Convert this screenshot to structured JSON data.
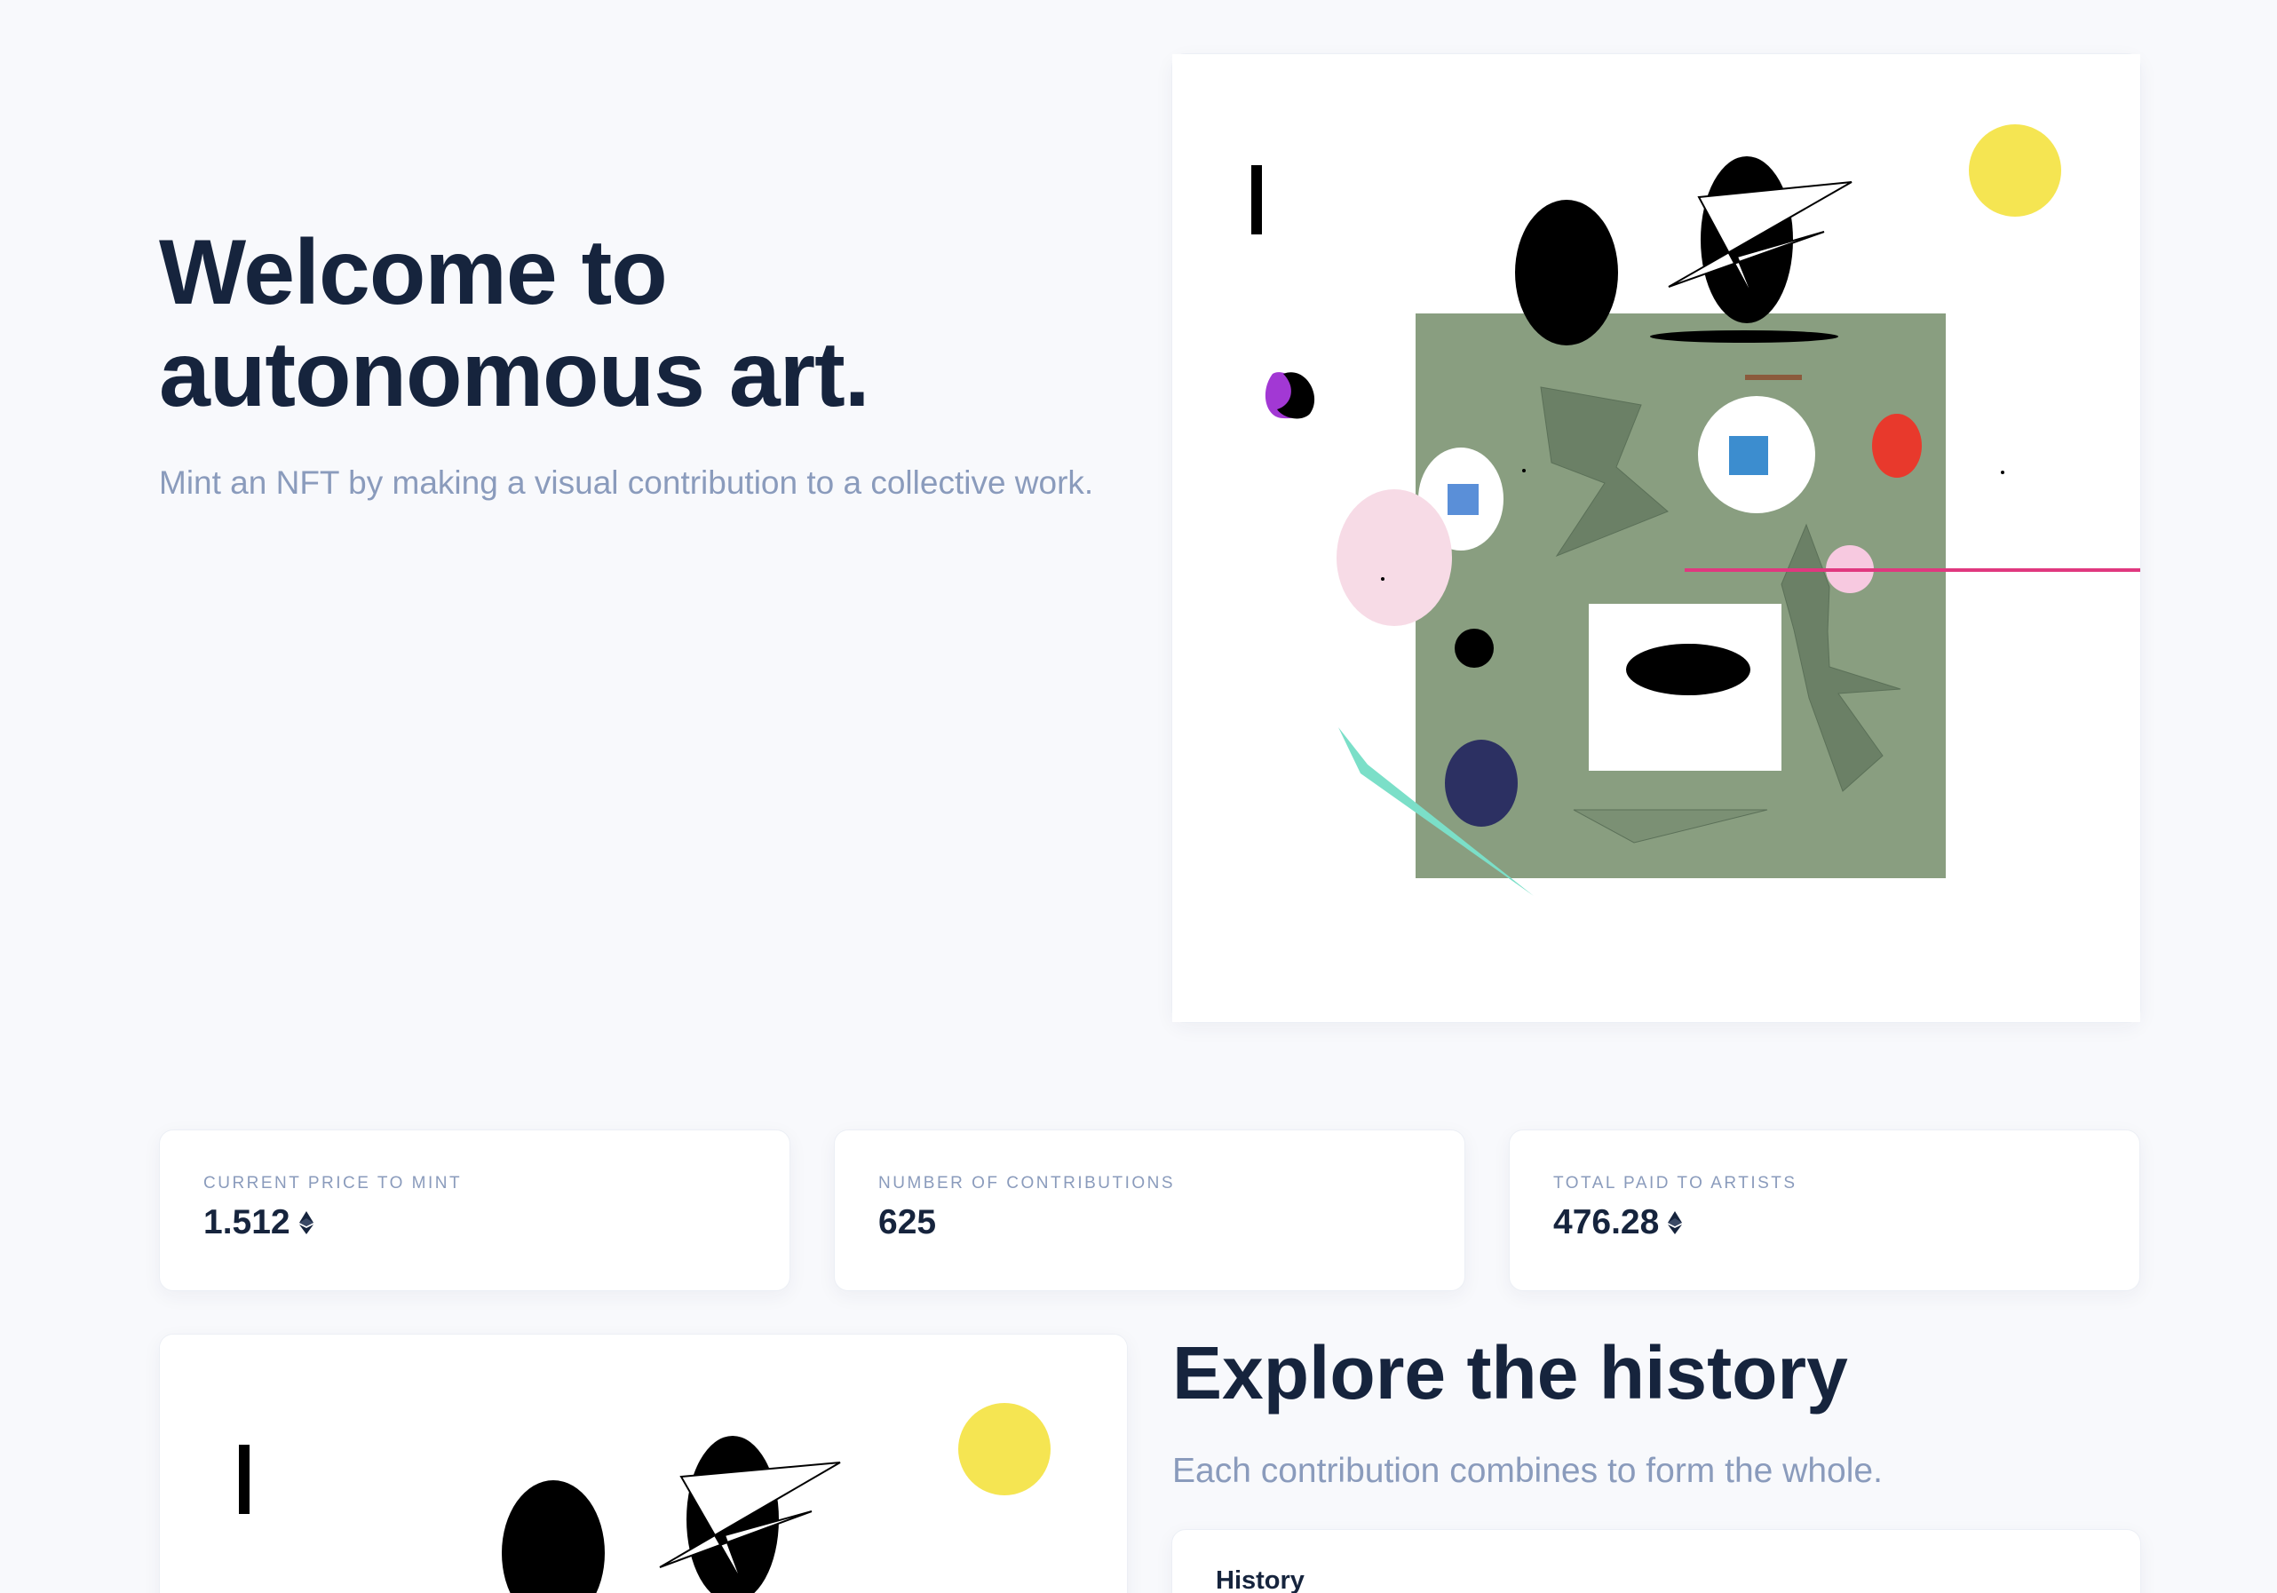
{
  "hero": {
    "title": "Welcome to autonomous art.",
    "subtitle": "Mint an NFT by making a visual contribution to a collective work."
  },
  "artwork": {
    "description_colors": {
      "background": "#ffffff",
      "green": "#899e80",
      "yellow": "#f5e552",
      "pink": "#f7dbe6",
      "red": "#e8392c",
      "blue": "#3c8dcf",
      "navy": "#2c3062",
      "teal": "#7bdfc8",
      "magenta": "#e0387f"
    }
  },
  "stats": [
    {
      "label": "Current price to mint",
      "value": "1.512",
      "icon": "ethereum-icon"
    },
    {
      "label": "Number of contributions",
      "value": "625"
    },
    {
      "label": "Total paid to artists",
      "value": "476.28",
      "icon": "ethereum-icon"
    }
  ],
  "history_section": {
    "title": "Explore the history",
    "subtitle": "Each contribution combines to form the whole.",
    "card_label": "History"
  },
  "colors": {
    "page_background": "#f8f9fc",
    "heading": "#16243d",
    "muted": "#8a9bbc",
    "card": "#ffffff"
  }
}
